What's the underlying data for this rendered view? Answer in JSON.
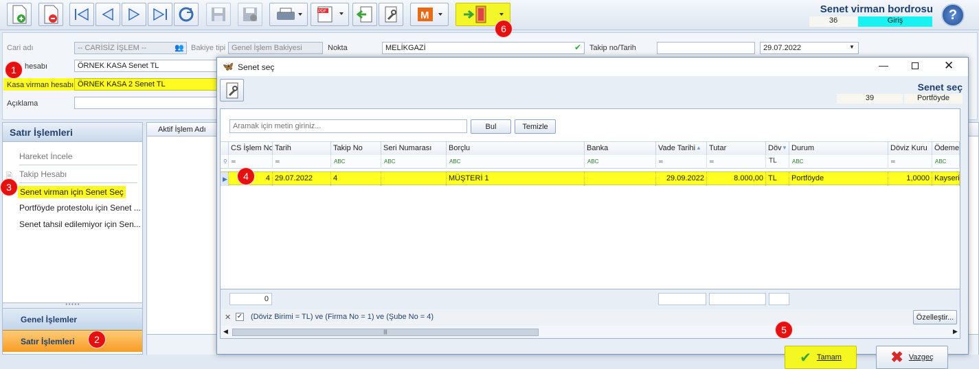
{
  "header": {
    "title": "Senet virman bordrosu",
    "code": "36",
    "direction": "Giriş"
  },
  "form": {
    "cari_label": "Cari adı",
    "cari_value": "-- CARİSİZ İŞLEM --",
    "bakiye_label": "Bakiye tipi",
    "bakiye_value": "Genel İşlem Bakiyesi",
    "nokta_label": "Nokta",
    "nokta_value": "MELİKGAZİ",
    "takip_label": "Takip no/Tarih",
    "takip_no": "",
    "takip_date": "29.07.2022",
    "kasa_label": "hesabı",
    "kasa_value": "ÖRNEK KASA Senet TL",
    "virman_label": "Kasa virman hesabı",
    "virman_value": "ÖRNEK KASA 2 Senet TL",
    "aciklama_label": "Açıklama",
    "aciklama_value": ""
  },
  "left_panel": {
    "title": "Satır İşlemleri",
    "items": [
      "Hareket İncele",
      "Takip Hesabı",
      "Senet virman için Senet Seç",
      "Portföyde protestolu için Senet ...",
      "Senet tahsil edilemiyor için Sen..."
    ],
    "bottom_general": "Genel İşlemler",
    "bottom_line": "Satır İşlemleri"
  },
  "main_grid": {
    "col1": "Aktif İşlem Adı"
  },
  "dialog": {
    "title": "Senet seç",
    "heading": "Senet seç",
    "count": "39",
    "status": "Portföyde",
    "search_placeholder": "Aramak için metin giriniz...",
    "find_label": "Bul",
    "clear_label": "Temizle",
    "columns": [
      "CS İşlem No",
      "Tarih",
      "Takip No",
      "Seri Numarası",
      "Borçlu",
      "Banka",
      "Vade Tarihi",
      "Tutar",
      "Döv",
      "Durum",
      "Döviz Kuru",
      "Ödeme"
    ],
    "filter_row": [
      "═",
      "═",
      "ABC",
      "ABC",
      "ABC",
      "ABC",
      "═",
      "═",
      "TL",
      "ABC",
      "═",
      "ABC"
    ],
    "rows": [
      [
        "4",
        "29.07.2022",
        "4",
        "",
        "MÜŞTERİ 1",
        "",
        "29.09.2022",
        "8.000,00",
        "TL",
        "Portföyde",
        "1,0000",
        "Kayseri"
      ]
    ],
    "footer_count": "0",
    "filter_text": "(Döviz Birimi = TL) ve (Firma No = 1) ve (Şube No = 4)",
    "customize_label": "Özelleştir...",
    "ok_label": "Tamam",
    "cancel_label": "Vazgeç"
  },
  "badges": [
    "1",
    "2",
    "3",
    "4",
    "5",
    "6"
  ]
}
